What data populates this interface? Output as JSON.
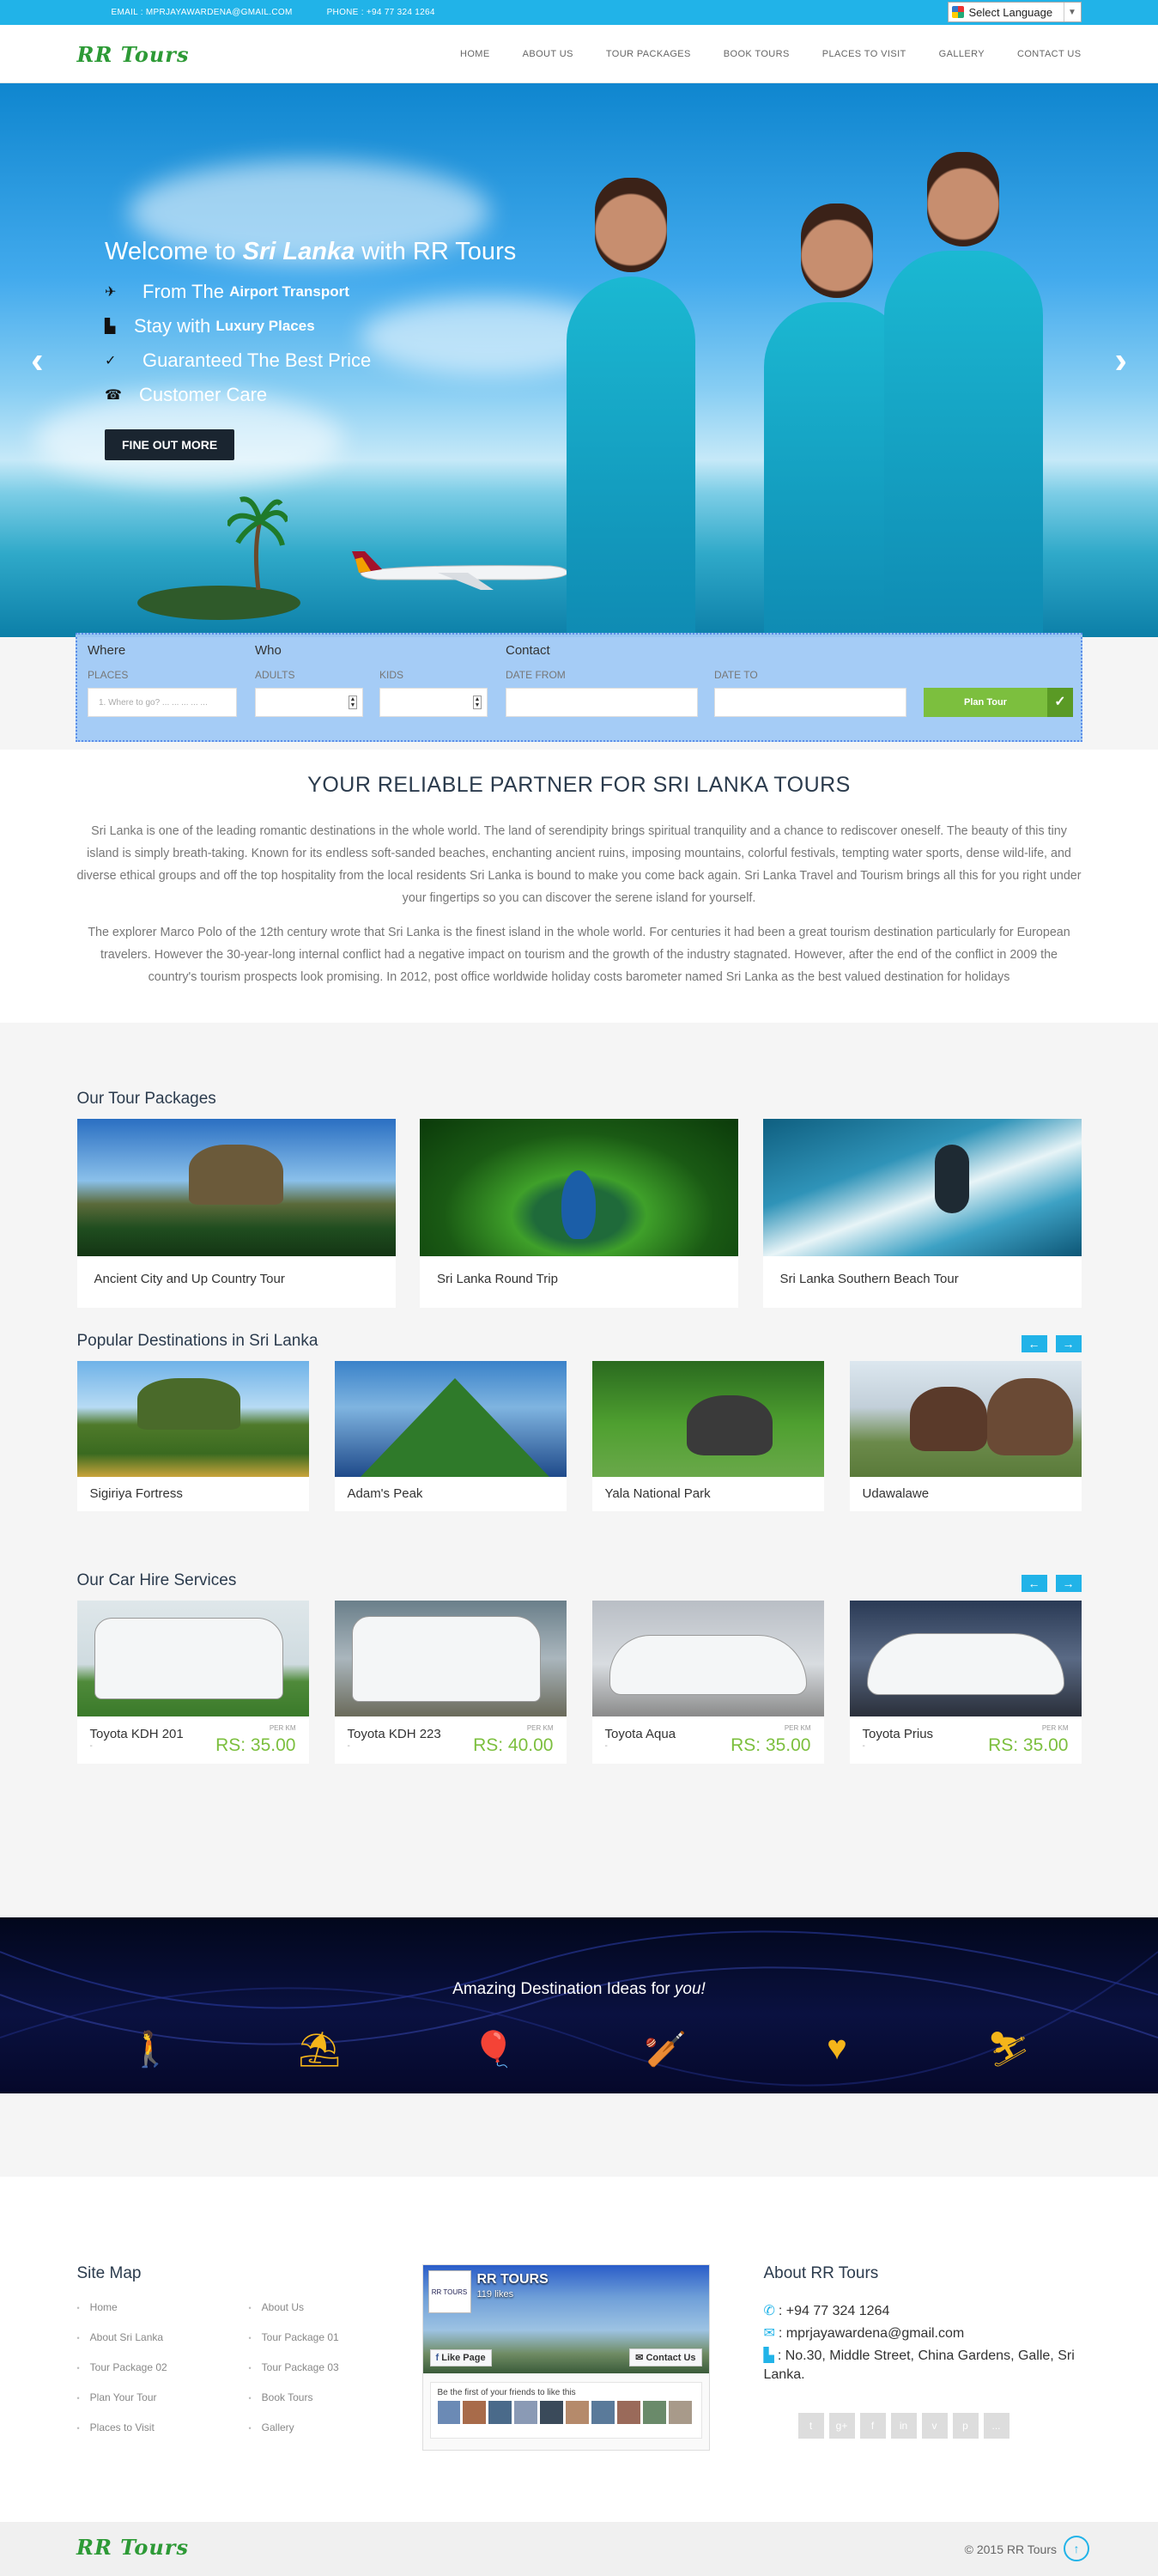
{
  "topbar": {
    "email": "EMAIL : MPRJAYAWARDENA@GMAIL.COM",
    "phone": "PHONE : +94 77 324 1264",
    "language": "Select Language"
  },
  "logo": "RR Tours",
  "menu": [
    "HOME",
    "ABOUT US",
    "TOUR PACKAGES",
    "BOOK TOURS",
    "PLACES TO VISIT",
    "GALLERY",
    "CONTACT US"
  ],
  "hero": {
    "title_prefix": "Welcome to ",
    "title_em": "Sri Lanka",
    "title_suffix": " with RR Tours",
    "lines": [
      {
        "text": "From The ",
        "bold": "Airport Transport"
      },
      {
        "text": "Stay with ",
        "bold": "Luxury Places"
      },
      {
        "text": "Guaranteed The Best Price",
        "bold": ""
      },
      {
        "text": "Customer Care",
        "bold": ""
      }
    ],
    "button": "FINE OUT MORE"
  },
  "search": {
    "where": "Where",
    "who": "Who",
    "contact": "Contact",
    "places_label": "PLACES",
    "places_placeholder": "1. Where to go? ... ... ... ... ...",
    "adults_label": "ADULTS",
    "kids_label": "KIDS",
    "date_from_label": "DATE FROM",
    "date_to_label": "DATE TO",
    "button": "Plan Tour"
  },
  "intro": {
    "title": "YOUR RELIABLE PARTNER FOR SRI LANKA TOURS",
    "p1": "Sri Lanka is one of the leading romantic destinations in the whole world. The land of serendipity brings spiritual tranquility and a chance to rediscover oneself. The beauty of this tiny island is simply breath-taking. Known for its endless soft-sanded beaches, enchanting ancient ruins, imposing mountains, colorful festivals, tempting water sports, dense wild-life, and diverse ethical groups and off the top hospitality from the local residents Sri Lanka is bound to make you come back again. Sri Lanka Travel and Tourism brings all this for you right under your fingertips so you can discover the serene island for yourself.",
    "p2": "The explorer Marco Polo of the 12th century wrote that Sri Lanka is the finest island in the whole world. For centuries it had been a great tourism destination particularly for European travelers. However the 30-year-long internal conflict had a negative impact on tourism and the growth of the industry stagnated. However, after the end of the conflict in 2009 the country's tourism prospects look promising. In 2012, post office worldwide holiday costs barometer named Sri Lanka as the best valued destination for holidays"
  },
  "packages": {
    "title": "Our Tour Packages",
    "items": [
      "Ancient City and Up Country Tour",
      "Sri Lanka Round Trip",
      "Sri Lanka Southern Beach Tour"
    ]
  },
  "destinations": {
    "title": "Popular Destinations in Sri Lanka",
    "items": [
      "Sigiriya Fortress",
      "Adam's Peak",
      "Yala National Park",
      "Udawalawe"
    ]
  },
  "cars": {
    "title": "Our Car Hire Services",
    "per_km": "PER KM",
    "dot": "-",
    "items": [
      {
        "name": "Toyota KDH 201",
        "price": "RS: 35.00"
      },
      {
        "name": "Toyota KDH 223",
        "price": "RS: 40.00"
      },
      {
        "name": "Toyota Aqua",
        "price": "RS: 35.00"
      },
      {
        "name": "Toyota Prius",
        "price": "RS: 35.00"
      }
    ]
  },
  "ideas": {
    "title_prefix": "Amazing Destination Ideas for ",
    "title_em": "you!",
    "icons": [
      "hiking-icon",
      "beach-icon",
      "balloons-icon",
      "sports-icon",
      "romance-icon",
      "adventure-icon"
    ]
  },
  "footer": {
    "sitemap_title": "Site Map",
    "sitemap": [
      "Home",
      "About Us",
      "About Sri Lanka",
      "Tour Package 01",
      "Tour Package 02",
      "Tour Package 03",
      "Plan Your Tour",
      "Book Tours",
      "Places to Visit",
      "Gallery"
    ],
    "fb_name": "RR TOURS",
    "fb_likes": "119 likes",
    "fb_like_btn": "Like Page",
    "fb_contact_btn": "Contact Us",
    "fb_friends": "Be the first of your friends to like this",
    "about_title": "About RR Tours",
    "phone": ": +94 77 324 1264",
    "email": ": mprjayawardena@gmail.com",
    "address": ": No.30, Middle Street, China Gardens, Galle, Sri Lanka.",
    "social": [
      "t",
      "g+",
      "f",
      "in",
      "v",
      "p",
      "..."
    ],
    "logo": "RR Tours",
    "copyright": "© 2015 RR Tours"
  },
  "colors": {
    "accent": "#21b3e8",
    "green": "#7cbf3e",
    "dark": "#2b3b4d"
  }
}
